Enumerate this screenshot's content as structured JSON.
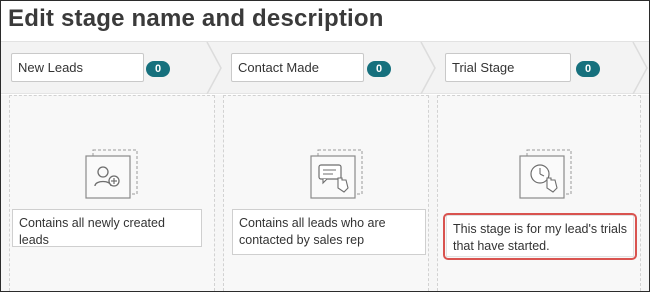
{
  "page": {
    "title": "Edit stage name and description"
  },
  "stages": [
    {
      "name": "New Leads",
      "count": "0",
      "icon": "user-add-icon",
      "description": "Contains all newly created leads"
    },
    {
      "name": "Contact Made",
      "count": "0",
      "icon": "chat-tap-icon",
      "description": "Contains all leads who are contacted by sales rep"
    },
    {
      "name": "Trial Stage",
      "count": "0",
      "icon": "timer-tap-icon",
      "description": "This stage is for my lead's trials that have started."
    }
  ],
  "colors": {
    "badge": "#16707d",
    "highlight": "#d9534f"
  }
}
